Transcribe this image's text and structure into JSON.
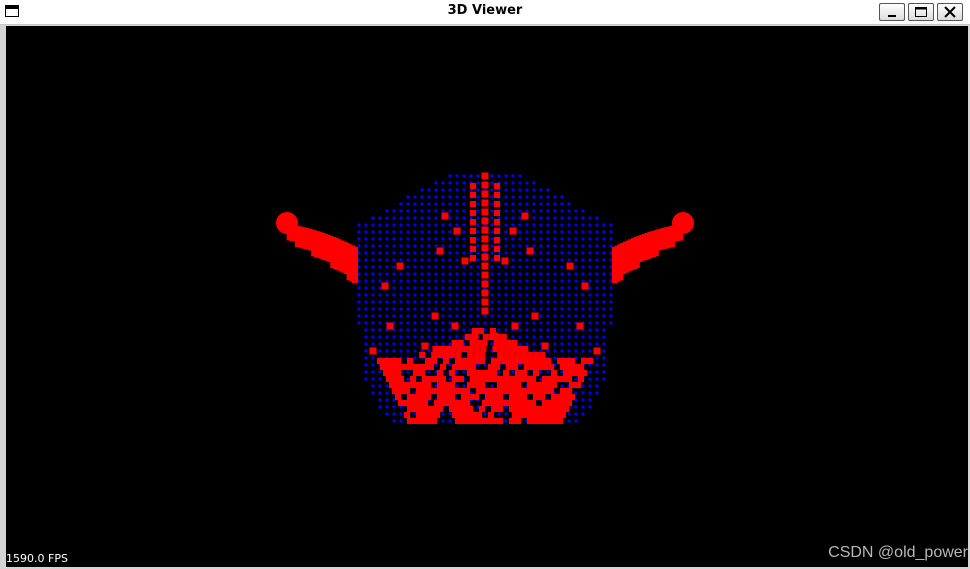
{
  "window": {
    "title": "3D Viewer",
    "controls": [
      "minimize",
      "maximize",
      "close"
    ]
  },
  "viewport": {
    "background": "#000000",
    "fps_text": "1590.0 FPS",
    "model_colors": {
      "vertices": "#0000ff",
      "highlight": "#ff0000"
    }
  },
  "watermark": "CSDN @old_power",
  "icons": {
    "app": "app-window-icon",
    "minimize": "minimize-icon",
    "maximize": "maximize-icon",
    "close": "close-icon"
  }
}
